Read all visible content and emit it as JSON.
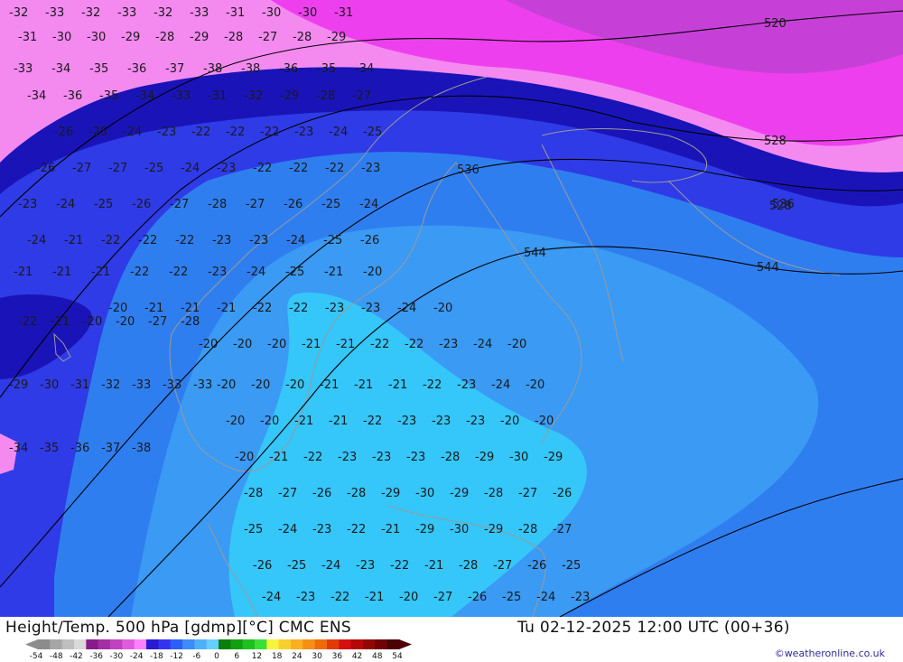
{
  "header": {
    "title": "Height/Temp. 500 hPa [gdmp][°C] CMC ENS",
    "valid_time": "Tu 02-12-2025 12:00 UTC (00+36)",
    "credit": "©weatheronline.co.uk"
  },
  "legend": {
    "tick_labels": [
      "-54",
      "-48",
      "-42",
      "-36",
      "-30",
      "-24",
      "-18",
      "-12",
      "-6",
      "0",
      "6",
      "12",
      "18",
      "24",
      "30",
      "36",
      "42",
      "48",
      "54"
    ],
    "colors": [
      "#8c8c8c",
      "#a6a6a6",
      "#bfbfbf",
      "#d9d9d9",
      "#8a1b8a",
      "#a52fa5",
      "#c241c2",
      "#e05ae0",
      "#ff80ff",
      "#2a1ad0",
      "#3434f0",
      "#2d5ef5",
      "#3b8cf7",
      "#4fb0fa",
      "#63d0ff",
      "#0a7f0a",
      "#11a011",
      "#1ec01e",
      "#38e038",
      "#f5f53a",
      "#f8d02c",
      "#f8b020",
      "#f59014",
      "#f06a0a",
      "#e03a06",
      "#d41010",
      "#b40808",
      "#920606",
      "#700404",
      "#4a0202"
    ]
  },
  "map": {
    "colors": {
      "m32": "#f48af0",
      "m34": "#ee3fee",
      "m36": "#c640d8",
      "m30": "#1a14b8",
      "m28": "#2f3be6",
      "m24": "#2f7ef0",
      "m22": "#3a9af4",
      "m20": "#35c6fa",
      "coast": "#9a9a9a",
      "isoline": "#000000"
    },
    "geopotential_labels": [
      "536",
      "544",
      "544",
      "528",
      "528",
      "536",
      "520"
    ],
    "temperature_labels": [
      "-32",
      "-33",
      "-32",
      "-33",
      "-32",
      "-33",
      "-31",
      "-30",
      "-30",
      "-31",
      "-31",
      "-30",
      "-30",
      "-29",
      "-28",
      "-29",
      "-28",
      "-27",
      "-28",
      "-29",
      "-33",
      "-34",
      "-35",
      "-36",
      "-37",
      "-38",
      "-38",
      "-36",
      "-35",
      "-34",
      "-34",
      "-36",
      "-35",
      "-34",
      "-33",
      "-31",
      "-32",
      "-29",
      "-28",
      "-27",
      "-26",
      "-25",
      "-24",
      "-23",
      "-22",
      "-22",
      "-22",
      "-23",
      "-24",
      "-25",
      "-26",
      "-27",
      "-27",
      "-25",
      "-24",
      "-23",
      "-22",
      "-22",
      "-22",
      "-23",
      "-23",
      "-24",
      "-25",
      "-26",
      "-27",
      "-28",
      "-27",
      "-26",
      "-25",
      "-24",
      "-24",
      "-21",
      "-22",
      "-22",
      "-22",
      "-23",
      "-23",
      "-24",
      "-25",
      "-26",
      "-21",
      "-21",
      "-21",
      "-22",
      "-22",
      "-23",
      "-24",
      "-25",
      "-21",
      "-20",
      "-20",
      "-21",
      "-21",
      "-21",
      "-22",
      "-22",
      "-23",
      "-23",
      "-24",
      "-20",
      "-20",
      "-20",
      "-20",
      "-21",
      "-21",
      "-22",
      "-22",
      "-23",
      "-24",
      "-20",
      "-20",
      "-20",
      "-20",
      "-21",
      "-21",
      "-21",
      "-22",
      "-23",
      "-24",
      "-20",
      "-20",
      "-20",
      "-21",
      "-21",
      "-22",
      "-23",
      "-23",
      "-23",
      "-20",
      "-20",
      "-20",
      "-21",
      "-22",
      "-23",
      "-23",
      "-23",
      "-28",
      "-29",
      "-30",
      "-29",
      "-28",
      "-27",
      "-26",
      "-28",
      "-29",
      "-30",
      "-29",
      "-28",
      "-27",
      "-26",
      "-25",
      "-24",
      "-23",
      "-22",
      "-21",
      "-29",
      "-30",
      "-29",
      "-28",
      "-27",
      "-26",
      "-25",
      "-24",
      "-23",
      "-22",
      "-21",
      "-28",
      "-27",
      "-26",
      "-25",
      "-24",
      "-23",
      "-22",
      "-21",
      "-20",
      "-27",
      "-26",
      "-25",
      "-24",
      "-23",
      "-22",
      "-21",
      "-20",
      "-20",
      "-27",
      "-28",
      "-29",
      "-30",
      "-31",
      "-32",
      "-33",
      "-33",
      "-33",
      "-34",
      "-35",
      "-36",
      "-37",
      "-38"
    ]
  }
}
